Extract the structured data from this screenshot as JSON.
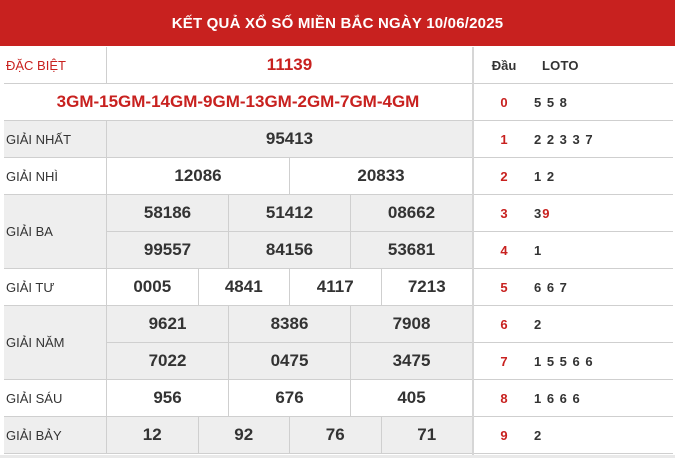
{
  "header": {
    "title": "KẾT QUẢ XỔ SỐ MIỀN BẮC NGÀY 10/06/2025"
  },
  "prizes": {
    "special": {
      "label": "ĐẶC BIỆT",
      "value": "11139"
    },
    "codes": "3GM-15GM-14GM-9GM-13GM-2GM-7GM-4GM",
    "first": {
      "label": "GIẢI NHẤT",
      "values": [
        "95413"
      ]
    },
    "second": {
      "label": "GIẢI NHÌ",
      "values": [
        "12086",
        "20833"
      ]
    },
    "third": {
      "label": "GIẢI BA",
      "values": [
        "58186",
        "51412",
        "08662",
        "99557",
        "84156",
        "53681"
      ]
    },
    "fourth": {
      "label": "GIẢI TƯ",
      "values": [
        "0005",
        "4841",
        "4117",
        "7213"
      ]
    },
    "fifth": {
      "label": "GIẢI NĂM",
      "values": [
        "9621",
        "8386",
        "7908",
        "7022",
        "0475",
        "3475"
      ]
    },
    "sixth": {
      "label": "GIẢI SÁU",
      "values": [
        "956",
        "676",
        "405"
      ]
    },
    "seventh": {
      "label": "GIẢI BẢY",
      "values": [
        "12",
        "92",
        "76",
        "71"
      ]
    }
  },
  "loto_table": {
    "head_label": "Đầu",
    "loto_label": "LOTO",
    "rows": [
      {
        "dau": "0",
        "loto": "5 5 8"
      },
      {
        "dau": "1",
        "loto": "2 2 3 3 7"
      },
      {
        "dau": "2",
        "loto": "1 2"
      },
      {
        "dau": "3",
        "loto_a": "3 ",
        "loto_hl": "9"
      },
      {
        "dau": "4",
        "loto": "1"
      },
      {
        "dau": "5",
        "loto": "6 6 7"
      },
      {
        "dau": "6",
        "loto": "2"
      },
      {
        "dau": "7",
        "loto": "1 5 5 6 6"
      },
      {
        "dau": "8",
        "loto": "1 6 6 6"
      },
      {
        "dau": "9",
        "loto": "2"
      }
    ]
  },
  "colors": {
    "accent": "#c8211f",
    "row_alt": "#eeeeee",
    "border": "#cfcfcf"
  }
}
